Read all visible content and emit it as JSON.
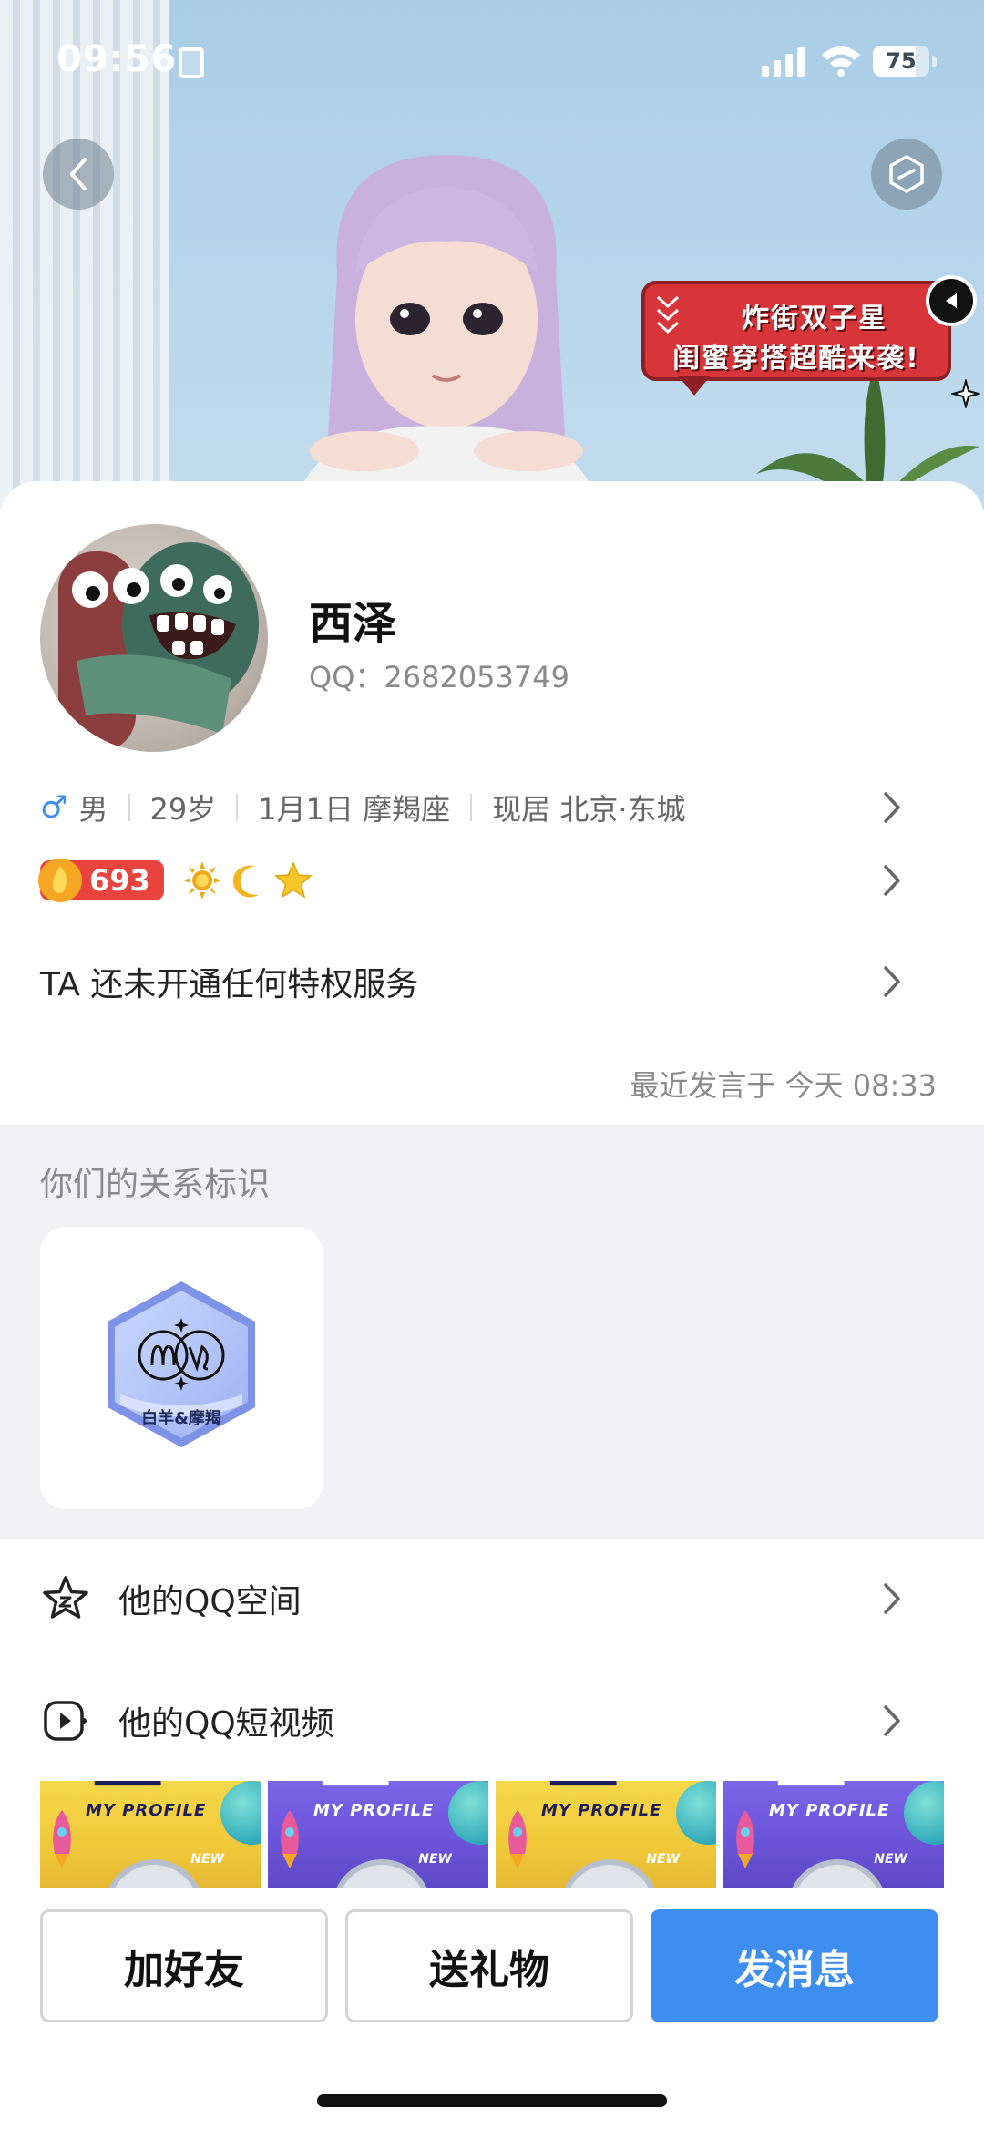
{
  "status_bar": {
    "time": "09:56",
    "battery": "75"
  },
  "banner": {
    "promo_line1": "炸街双子星",
    "promo_line2": "闺蜜穿搭超酷来袭!"
  },
  "profile": {
    "nickname": "西泽",
    "qq_label": "QQ：2682053749",
    "gender_symbol": "♂",
    "gender": "男",
    "age": "29岁",
    "birthday": "1月1日 摩羯座",
    "location": "现居 北京·东城",
    "level_value": "693",
    "privilege_text": "TA 还未开通任何特权服务",
    "last_post": "最近发言于 今天 08:33"
  },
  "relation": {
    "title": "你们的关系标识",
    "badge_label": "白羊&摩羯"
  },
  "menu": {
    "qzone_label": "他的QQ空间",
    "video_label": "他的QQ短视频"
  },
  "thumbnails": [
    {
      "theme": "yellow",
      "subtitle": "MY PROFILE",
      "tag": "NEW"
    },
    {
      "theme": "purple",
      "subtitle": "MY PROFILE",
      "tag": "NEW"
    },
    {
      "theme": "yellow",
      "subtitle": "MY PROFILE",
      "tag": "NEW"
    },
    {
      "theme": "purple",
      "subtitle": "MY PROFILE",
      "tag": "NEW"
    }
  ],
  "actions": {
    "add_friend": "加好友",
    "send_gift": "送礼物",
    "send_message": "发消息"
  },
  "colors": {
    "accent": "#3d8ef0",
    "level_badge": "#e8443d",
    "promo_red": "#d8353a"
  }
}
